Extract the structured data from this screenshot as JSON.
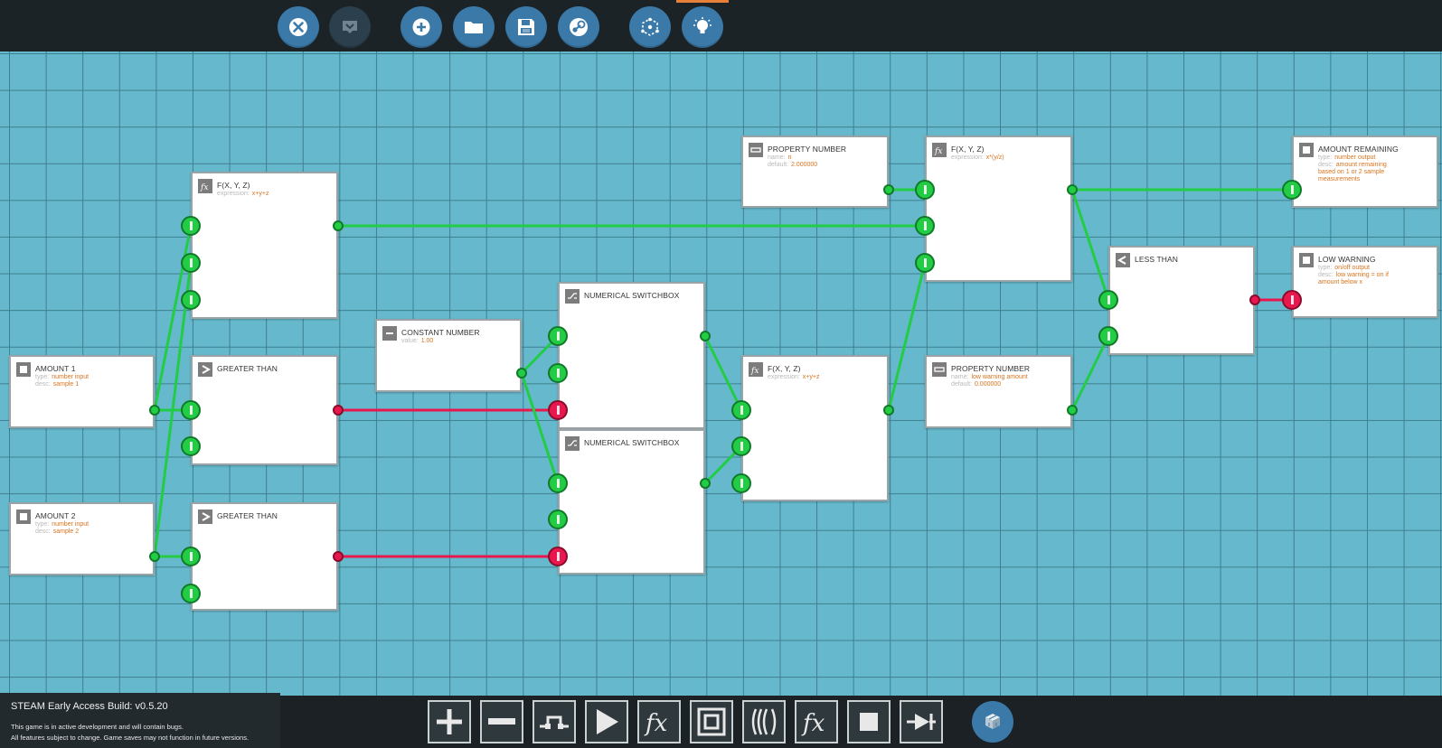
{
  "toolbar": {
    "buttons": [
      {
        "name": "close-icon"
      },
      {
        "name": "collapse-icon"
      },
      {
        "name": "add-icon"
      },
      {
        "name": "folder-icon"
      },
      {
        "name": "save-icon"
      },
      {
        "name": "steam-icon"
      },
      {
        "name": "recenter-icon"
      },
      {
        "name": "lightbulb-icon"
      }
    ]
  },
  "nodes": {
    "amount1": {
      "title": "AMOUNT 1",
      "type_key": "type:",
      "type": "number input",
      "desc_key": "desc:",
      "desc": "sample 1"
    },
    "amount2": {
      "title": "AMOUNT 2",
      "type_key": "type:",
      "type": "number input",
      "desc_key": "desc:",
      "desc": "sample 2"
    },
    "fxyz1": {
      "title": "F(X, Y, Z)",
      "expr_key": "expression:",
      "expr": "x+y+z"
    },
    "gt1": {
      "title": "GREATER THAN"
    },
    "gt2": {
      "title": "GREATER THAN"
    },
    "const": {
      "title": "CONSTANT NUMBER",
      "value_key": "value:",
      "value": "1.00"
    },
    "switch1": {
      "title": "NUMERICAL SWITCHBOX"
    },
    "switch2": {
      "title": "NUMERICAL SWITCHBOX"
    },
    "prop1": {
      "title": "PROPERTY NUMBER",
      "name_key": "name:",
      "name": "n",
      "default_key": "default:",
      "default": "2.000000"
    },
    "fxyz2": {
      "title": "F(X, Y, Z)",
      "expr_key": "expression:",
      "expr": "x+y+z"
    },
    "fxyz3": {
      "title": "F(X, Y, Z)",
      "expr_key": "expression:",
      "expr": "x*(y/z)"
    },
    "prop2": {
      "title": "PROPERTY NUMBER",
      "name_key": "name:",
      "name": "low warning amount",
      "default_key": "default:",
      "default": "0.000000"
    },
    "less": {
      "title": "LESS THAN"
    },
    "amount_remaining": {
      "title": "AMOUNT REMAINING",
      "type_key": "type:",
      "type": "number output",
      "desc_key": "desc:",
      "desc1": "amount remaining",
      "desc2": "based on 1 or 2 sample",
      "desc3": "measurements"
    },
    "low_warning": {
      "title": "LOW WARNING",
      "type_key": "type:",
      "type": "on/off output",
      "desc_key": "desc:",
      "desc1": "low warning = on if",
      "desc2": "amount below x"
    }
  },
  "colors": {
    "grid_background": "#66b9cc",
    "wire_on": "#22cc44",
    "wire_off": "#e8174e",
    "toolbar_button": "#3b7aa8",
    "tab_indicator": "#e6803a"
  },
  "build_info": {
    "title": "STEAM Early Access Build: v0.5.20",
    "line1": "This game is in active development and will contain bugs.",
    "line2": "All features subject to change. Game saves may not function in future versions."
  },
  "palette": {
    "items": [
      {
        "name": "add-node-icon"
      },
      {
        "name": "subtract-node-icon"
      },
      {
        "name": "pulse-node-icon"
      },
      {
        "name": "play-node-icon"
      },
      {
        "name": "fx-node-icon"
      },
      {
        "name": "bracket-node-icon"
      },
      {
        "name": "wave-node-icon"
      },
      {
        "name": "fx-alt-node-icon"
      },
      {
        "name": "stop-node-icon"
      },
      {
        "name": "arrow-node-icon"
      }
    ],
    "cube_icon": "cube-icon"
  }
}
